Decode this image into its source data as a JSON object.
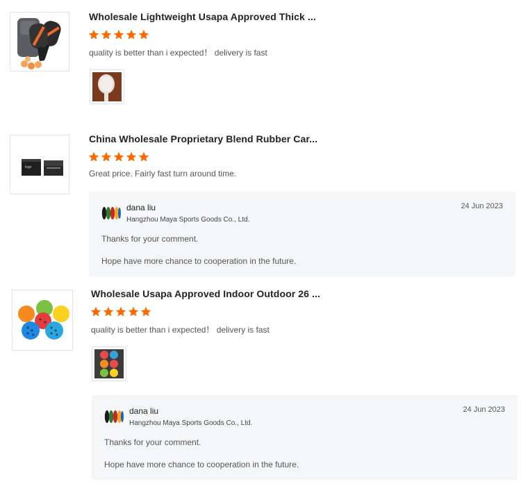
{
  "colors": {
    "star": "#ff6a00",
    "reply_bg": "#f5f6f8",
    "border": "#e3e3e3"
  },
  "reviews": [
    {
      "title": "Wholesale Lightweight Usapa Approved Thick ...",
      "rating": 5,
      "comment": "quality is better than i expected！ delivery is fast",
      "thumbnail_icon": "pickleball-paddle-set-icon",
      "photo_icon": "paddle-photo-icon"
    },
    {
      "title": "China Wholesale Proprietary Blend Rubber Car...",
      "rating": 5,
      "comment": "Great price.  Fairly fast turn around time.",
      "thumbnail_icon": "black-box-icon",
      "reply": {
        "name": "dana liu",
        "company": "Hangzhou Maya Sports Goods Co., Ltd.",
        "date": "24 Jun 2023",
        "line1": "Thanks for your comment.",
        "line2": "Hope have more chance to cooperation in the future."
      }
    },
    {
      "title": "Wholesale Usapa Approved Indoor Outdoor 26 ...",
      "rating": 5,
      "comment": "quality is better than i expected！ delivery is fast",
      "thumbnail_icon": "pickleballs-icon",
      "photo_icon": "pickleballs-photo-icon",
      "reply": {
        "name": "dana liu",
        "company": "Hangzhou Maya Sports Goods Co., Ltd.",
        "date": "24 Jun 2023",
        "line1": "Thanks for your comment.",
        "line2": "Hope have more chance to cooperation in the future."
      }
    }
  ]
}
